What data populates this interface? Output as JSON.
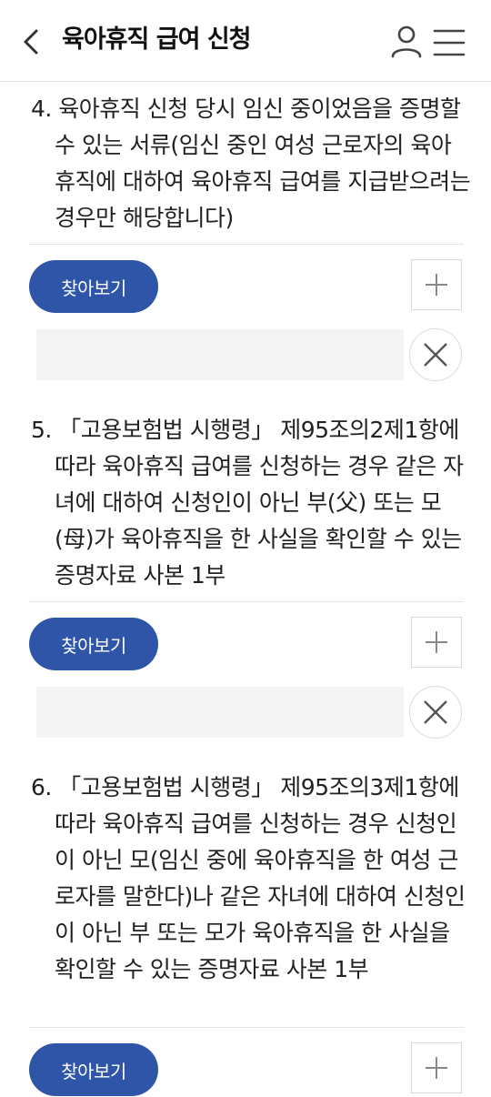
{
  "header": {
    "title": "육아휴직 급여 신청",
    "back_icon": "chevron-left-icon",
    "user_icon": "user-icon",
    "menu_icon": "hamburger-menu-icon"
  },
  "items": [
    {
      "text": "4. 육아휴직 신청 당시 임신 중이었음을 증명할 수 있는 서류(임신 중인 여성 근로자의 육아휴직에 대하여 육아휴직 급여를 지급받으려는 경우만 해당합니다)",
      "browse_label": "찾아보기",
      "file_value": ""
    },
    {
      "text": "5. 「고용보험법 시행령」 제95조의2제1항에 따라 육아휴직 급여를 신청하는 경우 같은 자녀에 대하여 신청인이 아닌 부(父) 또는 모(母)가 육아휴직을 한 사실을 확인할 수 있는 증명자료 사본 1부",
      "browse_label": "찾아보기",
      "file_value": ""
    },
    {
      "text": "6. 「고용보험법 시행령」 제95조의3제1항에 따라 육아휴직 급여를 신청하는 경우 신청인이 아닌 모(임신 중에 육아휴직을 한 여성 근로자를 말한다)나 같은 자녀에 대하여 신청인이 아닌 부 또는 모가 육아휴직을 한 사실을 확인할 수 있는 증명자료 사본 1부",
      "browse_label": "찾아보기"
    }
  ],
  "colors": {
    "accent": "#2f55a8",
    "field_bg": "#f4f4f4",
    "divider": "#e6e6e6"
  }
}
